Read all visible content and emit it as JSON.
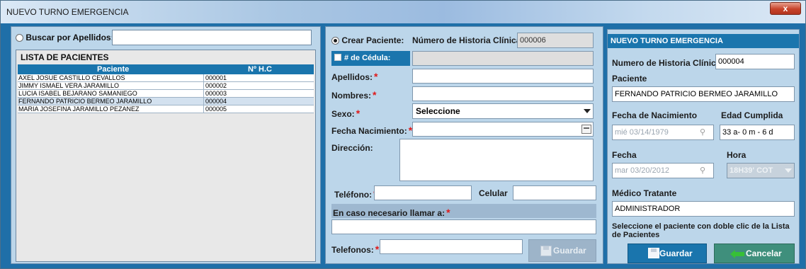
{
  "window": {
    "title": "NUEVO TURNO EMERGENCIA",
    "close_glyph": "x"
  },
  "search": {
    "label": "Buscar por Apellidos:",
    "value": ""
  },
  "patients": {
    "title": "LISTA DE PACIENTES",
    "columns": [
      "Paciente",
      "Nº H.C"
    ],
    "rows": [
      {
        "name": "AXEL JOSUE CASTILLO CEVALLOS",
        "hc": "000001"
      },
      {
        "name": "JIMMY ISMAEL VERA JARAMILLO",
        "hc": "000002"
      },
      {
        "name": "LUCIA ISABEL BEJARANO SAMANIEGO",
        "hc": "000003"
      },
      {
        "name": "FERNANDO PATRICIO BERMEO JARAMILLO",
        "hc": "000004"
      },
      {
        "name": "MARIA JOSEFINA JARAMILLO PEZANEZ",
        "hc": "000005"
      }
    ]
  },
  "create": {
    "radio_label": "Crear Paciente:",
    "hc_label": "Número de Historia Clínica:",
    "hc_value": "000006",
    "cedula_label": "# de Cédula:",
    "apellidos_label": "Apellidos:",
    "nombres_label": "Nombres:",
    "sexo_label": "Sexo:",
    "sexo_value": "Seleccione",
    "fecha_nac_label": "Fecha Nacimiento:",
    "direccion_label": "Dirección:",
    "telefono_label": "Teléfono:",
    "celular_label": "Celular",
    "emergencia_label": "En caso necesario llamar a:",
    "telefonos_label": "Telefonos:",
    "guardar_label": "Guardar",
    "required_mark": "*"
  },
  "turno": {
    "header": "NUEVO TURNO EMERGENCIA",
    "hc_label": "Numero de Historia Clínica:",
    "hc_value": "000004",
    "paciente_label": "Paciente",
    "paciente_value": "FERNANDO PATRICIO BERMEO JARAMILLO",
    "fecha_nac_label": "Fecha de Nacimiento",
    "fecha_nac_value": "mié 03/14/1979",
    "edad_label": "Edad Cumplida",
    "edad_value": "33 a- 0 m - 6 d",
    "fecha_label": "Fecha",
    "fecha_value": "mar 03/20/2012",
    "hora_label": "Hora",
    "hora_value": "18H39' COT",
    "medico_label": "Médico Tratante",
    "medico_value": "ADMINISTRADOR",
    "hint": "Seleccione el paciente con doble clic de la Lista de Pacientes",
    "guardar_label": "Guardar",
    "cancelar_label": "Cancelar"
  },
  "icons": [
    "close-icon",
    "radio-icon",
    "checkbox-icon",
    "calendar-icon",
    "dropdown-arrow-icon",
    "save-icon",
    "back-arrow-icon",
    "pin-icon"
  ]
}
